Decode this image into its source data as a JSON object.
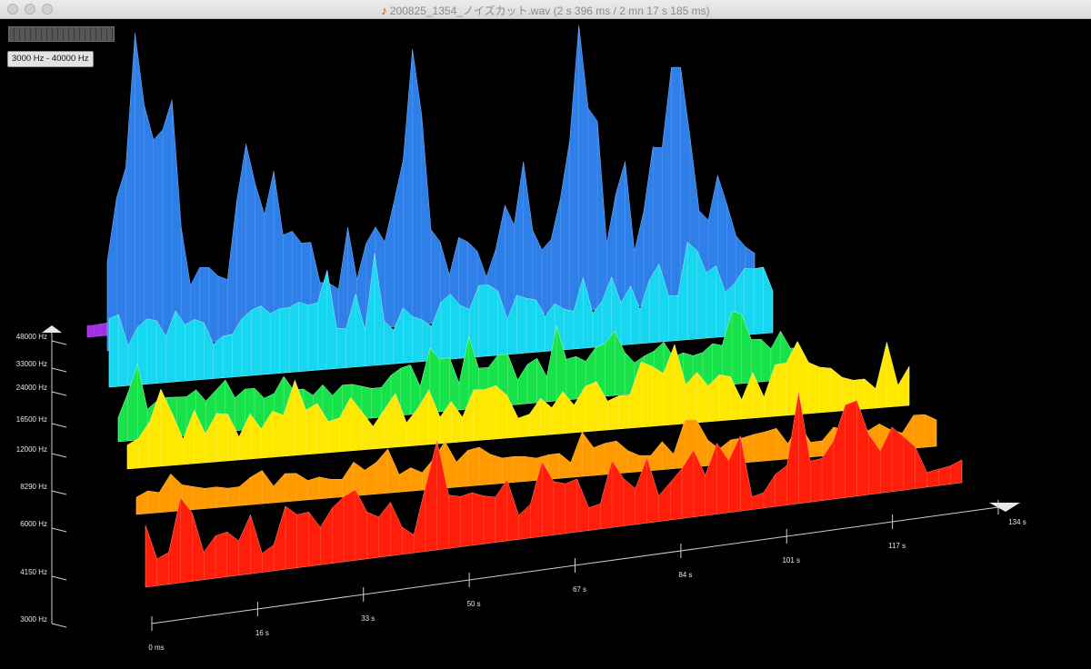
{
  "window": {
    "title": "200825_1354_ノイズカット.wav (2 s 396 ms / 2 mn 17 s 185 ms)",
    "file_icon": "audio-file-icon"
  },
  "toolbar": {
    "range_label": "3000 Hz - 40000 Hz"
  },
  "colors": {
    "background": "#000000",
    "low_band": "#ff1e0a",
    "mid_low_band": "#ff9a00",
    "mid_band": "#ffe800",
    "green_band": "#18e24a",
    "cyan_band": "#16d6f0",
    "blue_band": "#2f7fe8",
    "violet_band": "#a030e0"
  },
  "chart_data": {
    "type": "area",
    "subtype": "3d-spectrogram-waterfall",
    "title": "",
    "xlabel": "",
    "ylabel": "",
    "x_ticks": [
      "0 ms",
      "16 s",
      "33 s",
      "50 s",
      "67 s",
      "84 s",
      "101 s",
      "117 s",
      "134 s"
    ],
    "freq_ticks": [
      "3000 Hz",
      "4150 Hz",
      "6000 Hz",
      "8290 Hz",
      "12000 Hz",
      "16500 Hz",
      "24000 Hz",
      "33000 Hz",
      "48000 Hz"
    ],
    "xlim": [
      0,
      134
    ],
    "freq_range": [
      3000,
      48000
    ],
    "grid": false
  }
}
